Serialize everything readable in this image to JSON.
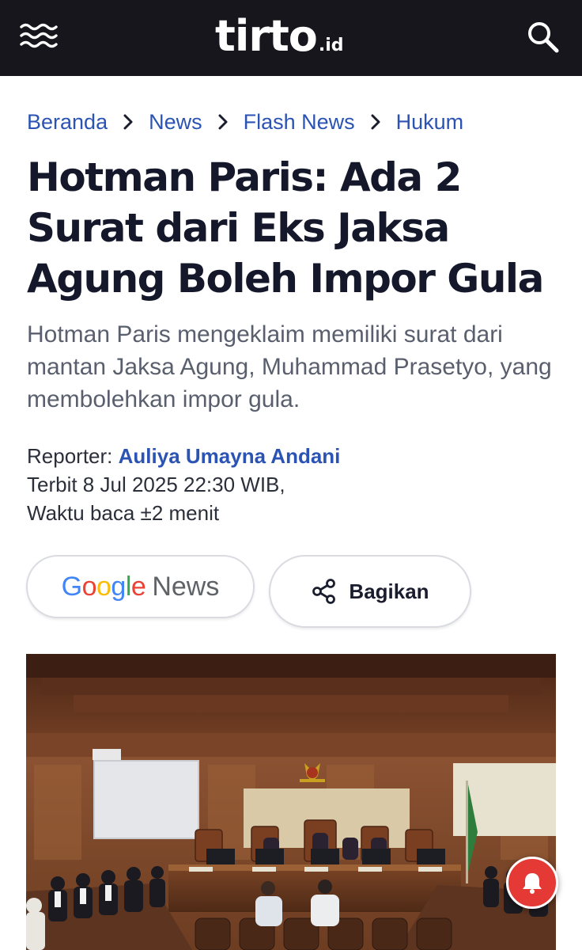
{
  "header": {
    "logo_main": "tirto",
    "logo_suffix": ".id",
    "menu_icon": "hamburger-wave-icon",
    "search_icon": "search-icon",
    "background_color": "#16161c"
  },
  "breadcrumb": [
    {
      "label": "Beranda"
    },
    {
      "label": "News"
    },
    {
      "label": "Flash News"
    },
    {
      "label": "Hukum"
    }
  ],
  "article": {
    "title": "Hotman Paris: Ada 2 Surat dari Eks Jaksa Agung Boleh Impor Gula",
    "subtitle": "Hotman Paris mengeklaim memiliki surat dari mantan Jaksa Agung, Muhammad Prasetyo, yang membolehkan impor gula.",
    "reporter_label": "Reporter:",
    "reporter_name": "Auliya Umayna Andani",
    "published": "Terbit 8 Jul 2025 22:30 WIB,",
    "read_time": "Waktu baca ±2 menit"
  },
  "actions": {
    "google_news": {
      "brand": [
        "G",
        "o",
        "o",
        "g",
        "l",
        "e"
      ],
      "label": "News"
    },
    "share": {
      "icon": "share-icon",
      "label": "Bagikan"
    }
  },
  "photo": {
    "subject": "courtroom-photo"
  },
  "notification": {
    "icon": "bell-icon",
    "color": "#e53935"
  },
  "colors": {
    "link": "#2b53b3",
    "headline": "#14182a",
    "google_blue": "#4285f4",
    "google_red": "#ea4335",
    "google_yellow": "#fbbc05",
    "google_green": "#34a853"
  }
}
